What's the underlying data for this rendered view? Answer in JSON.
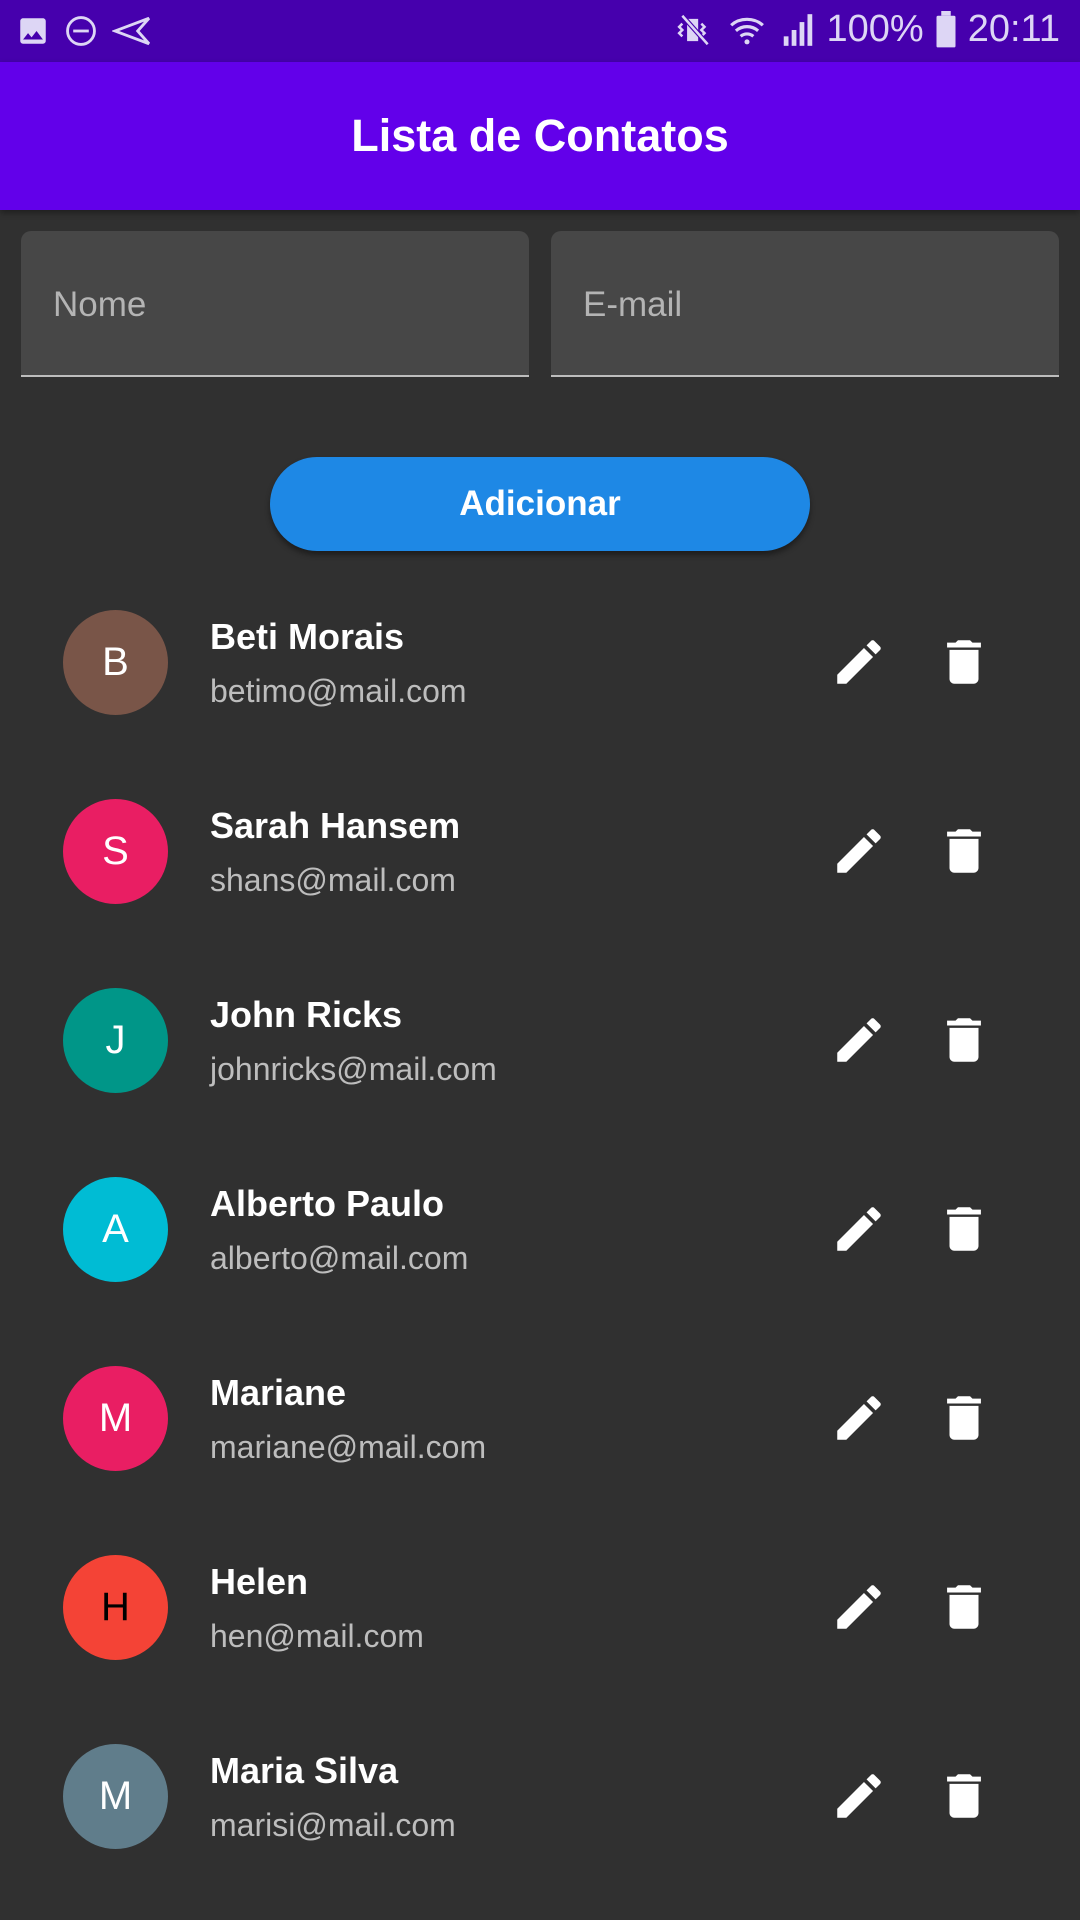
{
  "status_bar": {
    "battery": "100%",
    "time": "20:11"
  },
  "app_bar": {
    "title": "Lista de Contatos"
  },
  "form": {
    "name_placeholder": "Nome",
    "name_value": "",
    "email_placeholder": "E-mail",
    "email_value": "",
    "add_label": "Adicionar"
  },
  "contacts": [
    {
      "initial": "B",
      "name": "Beti Morais",
      "email": "betimo@mail.com",
      "color": "#795548",
      "text_color": "#ffffff"
    },
    {
      "initial": "S",
      "name": "Sarah Hansem",
      "email": "shans@mail.com",
      "color": "#e91e63",
      "text_color": "#ffffff"
    },
    {
      "initial": "J",
      "name": "John Ricks",
      "email": "johnricks@mail.com",
      "color": "#009688",
      "text_color": "#ffffff"
    },
    {
      "initial": "A",
      "name": "Alberto Paulo",
      "email": "alberto@mail.com",
      "color": "#00bcd4",
      "text_color": "#ffffff"
    },
    {
      "initial": "M",
      "name": "Mariane",
      "email": "mariane@mail.com",
      "color": "#e91e63",
      "text_color": "#ffffff"
    },
    {
      "initial": "H",
      "name": "Helen",
      "email": "hen@mail.com",
      "color": "#f44336",
      "text_color": "#000000"
    },
    {
      "initial": "M",
      "name": "Maria Silva",
      "email": "marisi@mail.com",
      "color": "#607d8b",
      "text_color": "#ffffff"
    }
  ],
  "icons": {
    "edit": "pencil-icon",
    "delete": "trash-icon"
  }
}
